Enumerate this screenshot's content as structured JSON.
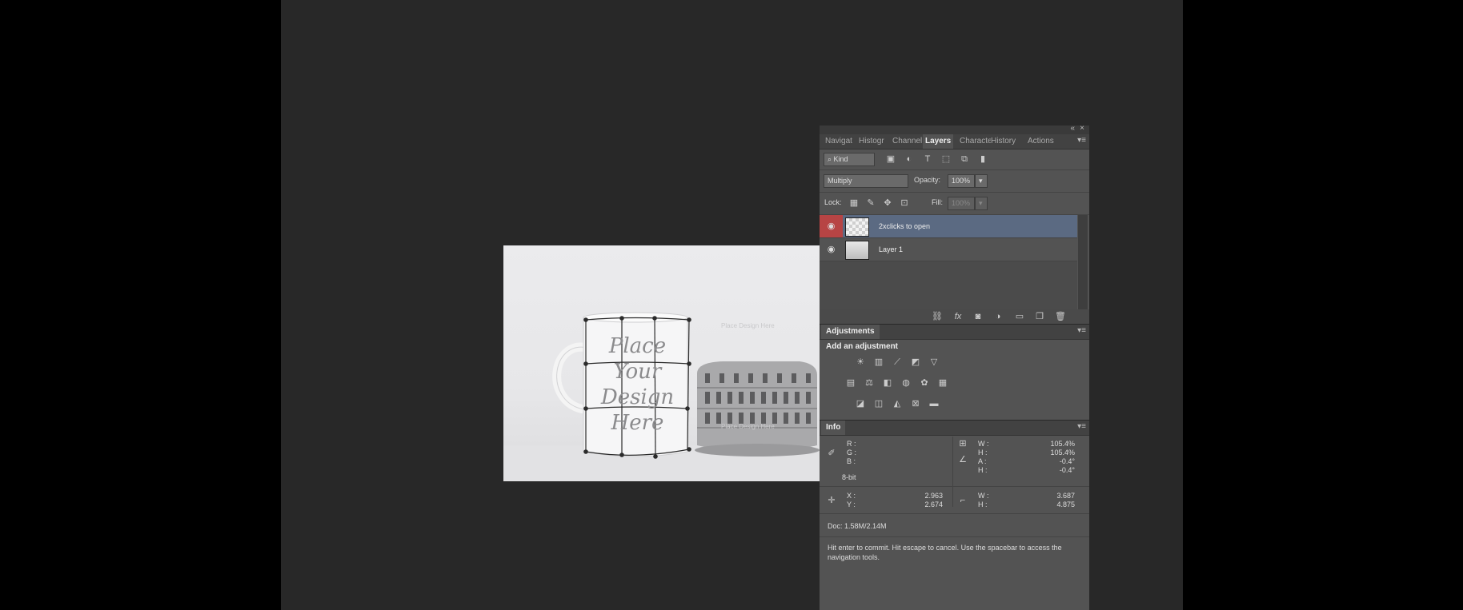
{
  "canvas": {
    "mockup_text": [
      "Place",
      "Your",
      "Design",
      "Here"
    ],
    "watermarks": [
      "Place Design Here",
      "Place Design Here"
    ]
  },
  "layers_panel": {
    "tabs": [
      "Navigat",
      "Histogr",
      "Channel",
      "Layers",
      "Characte",
      "History",
      "Actions"
    ],
    "active_tab": "Layers",
    "filter_kind": "Kind",
    "blend_mode": "Multiply",
    "opacity_label": "Opacity:",
    "opacity_value": "100%",
    "lock_label": "Lock:",
    "fill_label": "Fill:",
    "fill_value": "100%",
    "layers": [
      {
        "name": "2xclicks to open",
        "selected": true
      },
      {
        "name": "Layer 1",
        "selected": false
      }
    ]
  },
  "adjustments_panel": {
    "tab": "Adjustments",
    "heading": "Add an adjustment"
  },
  "info_panel": {
    "tab": "Info",
    "rgb_labels": [
      "R :",
      "G :",
      "B :"
    ],
    "bit_depth": "8-bit",
    "transform": {
      "W_label": "W :",
      "W": "105.4%",
      "H_label": "H :",
      "H": "105.4%",
      "A_label": "A :",
      "A": "-0.4°",
      "H2_label": "H :",
      "H2": "-0.4°"
    },
    "coords": {
      "X_label": "X :",
      "X": "2.963",
      "Y_label": "Y :",
      "Y": "2.674"
    },
    "size": {
      "W_label": "W :",
      "W": "3.687",
      "H_label": "H :",
      "H": "4.875"
    },
    "doc": "Doc: 1.58M/2.14M",
    "hint": "Hit enter to commit. Hit escape to cancel. Use the spacebar to access the navigation tools."
  },
  "colors": {
    "workspace": "#282828",
    "panel": "#535353",
    "selected_layer": "#5b6a82",
    "eye_active": "#b74444"
  }
}
